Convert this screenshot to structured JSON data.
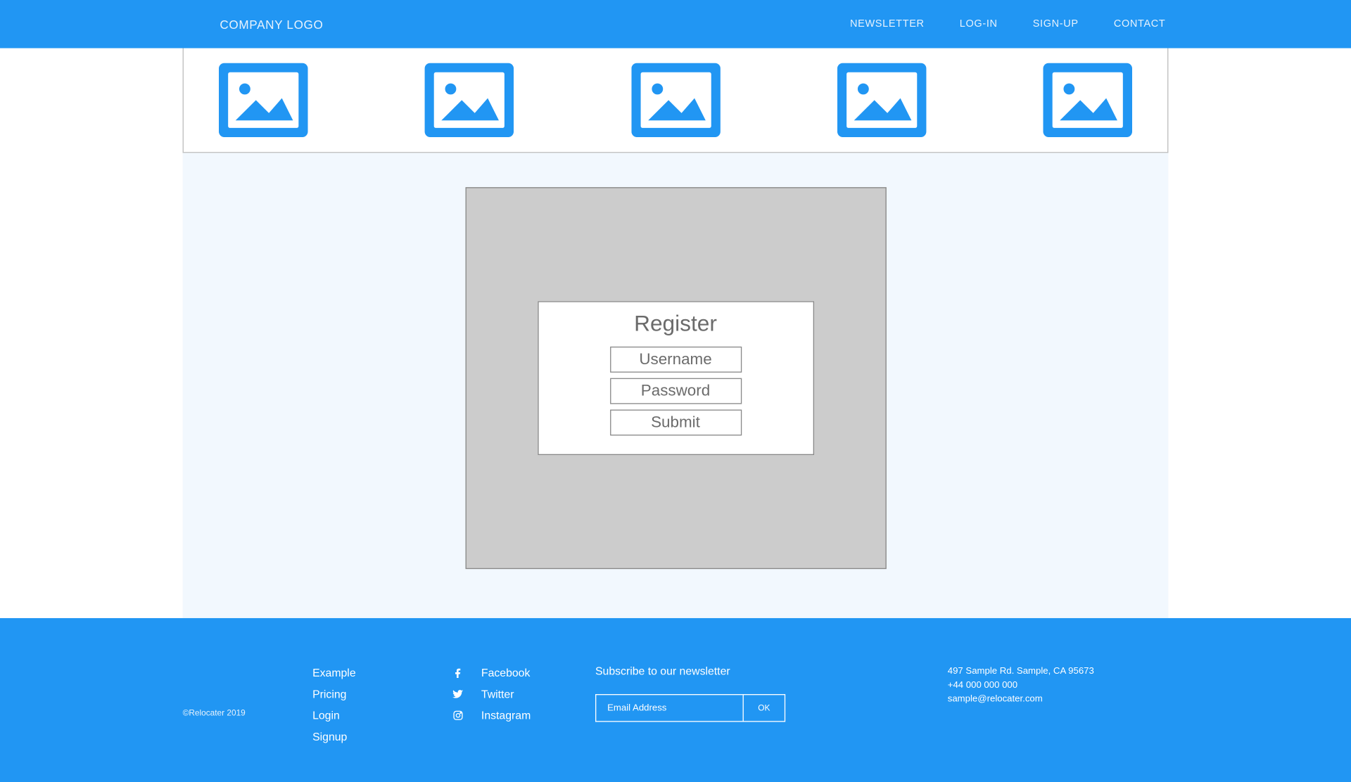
{
  "header": {
    "logo": "COMPANY LOGO",
    "nav": {
      "newsletter": "NEWSLETTER",
      "login": "LOG-IN",
      "signup": "SIGN-UP",
      "contact": "CONTACT"
    }
  },
  "register": {
    "title": "Register",
    "username_placeholder": "Username",
    "password_placeholder": "Password",
    "submit_label": "Submit"
  },
  "footer": {
    "copyright": "©Relocater 2019",
    "links": {
      "example": "Example",
      "pricing": "Pricing",
      "login": "Login",
      "signup": "Signup"
    },
    "social": {
      "facebook": "Facebook",
      "twitter": "Twitter",
      "instagram": "Instagram"
    },
    "newsletter": {
      "title": "Subscribe to our newsletter",
      "placeholder": "Email Address",
      "button": "OK"
    },
    "contact": {
      "address": "497 Sample Rd. Sample, CA 95673",
      "phone": "+44 000 000 000",
      "email": "sample@relocater.com"
    }
  },
  "colors": {
    "primary": "#2196F3",
    "light_bg": "#F2F8FE",
    "placeholder_bg": "#cccccc"
  }
}
